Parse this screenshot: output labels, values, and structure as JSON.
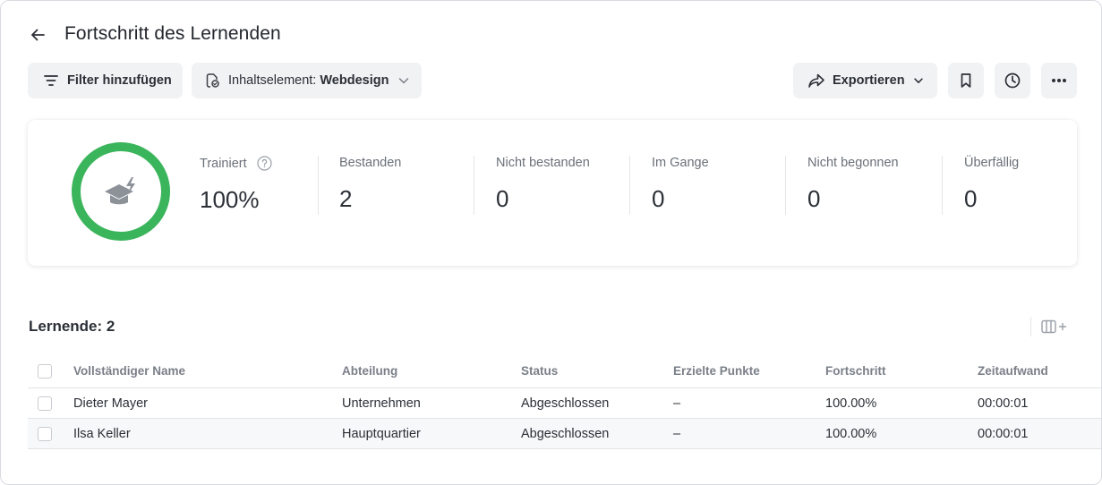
{
  "header": {
    "title": "Fortschritt des Lernenden"
  },
  "toolbar": {
    "filter_label": "Filter hinzufügen",
    "content_prefix": "Inhaltselement: ",
    "content_value": "Webdesign",
    "export_label": "Exportieren"
  },
  "summary": {
    "trained_label": "Trainiert",
    "trained_value": "100%",
    "trained_progress": 1.0,
    "ring_color": "#3bb55c",
    "stats": [
      {
        "label": "Bestanden",
        "value": "2"
      },
      {
        "label": "Nicht bestanden",
        "value": "0"
      },
      {
        "label": "Im Gange",
        "value": "0"
      },
      {
        "label": "Nicht begonnen",
        "value": "0"
      },
      {
        "label": "Überfällig",
        "value": "0"
      }
    ]
  },
  "learners": {
    "title": "Lernende: 2",
    "columns": [
      "Vollständiger Name",
      "Abteilung",
      "Status",
      "Erzielte Punkte",
      "Fortschritt",
      "Zeitaufwand"
    ],
    "rows": [
      {
        "name": "Dieter Mayer",
        "department": "Unternehmen",
        "status": "Abgeschlossen",
        "score": "–",
        "progress": "100.00%",
        "time": "00:00:01"
      },
      {
        "name": "Ilsa Keller",
        "department": "Hauptquartier",
        "status": "Abgeschlossen",
        "score": "–",
        "progress": "100.00%",
        "time": "00:00:01"
      }
    ]
  },
  "icons": {
    "back": "arrow-left-icon",
    "filter": "filter-icon",
    "content": "content-item-icon",
    "export": "share-arrow-icon",
    "bookmark": "bookmark-icon",
    "history": "clock-icon",
    "more": "more-dots-icon",
    "columns": "columns-add-icon",
    "graduation": "graduation-cap-icon"
  }
}
